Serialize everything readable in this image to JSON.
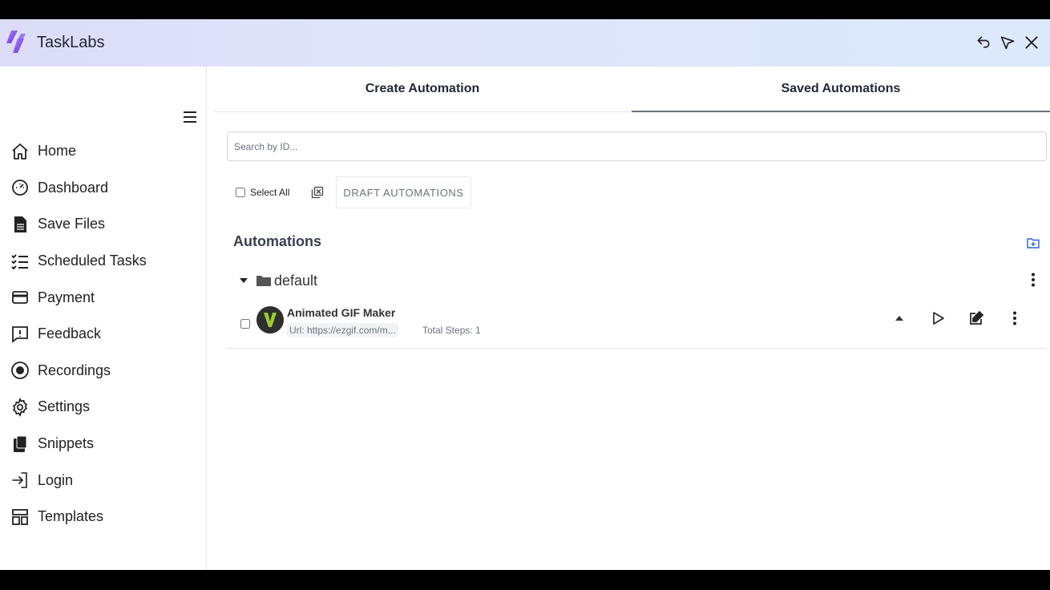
{
  "app": {
    "title": "TaskLabs"
  },
  "header": {
    "icons": [
      "undo-icon",
      "pointer-icon",
      "close-icon"
    ]
  },
  "sidebar": {
    "items": [
      {
        "label": "Home",
        "icon": "home-icon"
      },
      {
        "label": "Dashboard",
        "icon": "dashboard-icon"
      },
      {
        "label": "Save Files",
        "icon": "file-icon"
      },
      {
        "label": "Scheduled Tasks",
        "icon": "tasks-icon"
      },
      {
        "label": "Payment",
        "icon": "card-icon"
      },
      {
        "label": "Feedback",
        "icon": "feedback-icon"
      },
      {
        "label": "Recordings",
        "icon": "record-icon"
      },
      {
        "label": "Settings",
        "icon": "gear-icon"
      },
      {
        "label": "Snippets",
        "icon": "snippets-icon"
      },
      {
        "label": "Login",
        "icon": "login-icon"
      },
      {
        "label": "Templates",
        "icon": "templates-icon"
      }
    ]
  },
  "tabs": [
    {
      "label": "Create Automation",
      "active": false
    },
    {
      "label": "Saved Automations",
      "active": true
    }
  ],
  "search": {
    "placeholder": "Search by ID...",
    "value": ""
  },
  "toolbar": {
    "select_all_label": "Select All",
    "draft_label": "DRAFT AUTOMATIONS"
  },
  "automations": {
    "title": "Automations",
    "folders": [
      {
        "name": "default",
        "expanded": true,
        "items": [
          {
            "name": "Animated GIF Maker",
            "url": "Url: https://ezgif.com/m...",
            "steps": "Total Steps: 1",
            "avatar_letter": "V"
          }
        ]
      }
    ]
  },
  "colors": {
    "accent": "#4f46e5",
    "avatar_bg": "#2f2f2f",
    "avatar_letter": "#9acd32",
    "header_gradient_start": "#dcdcf7",
    "header_gradient_end": "#dce8fc"
  }
}
